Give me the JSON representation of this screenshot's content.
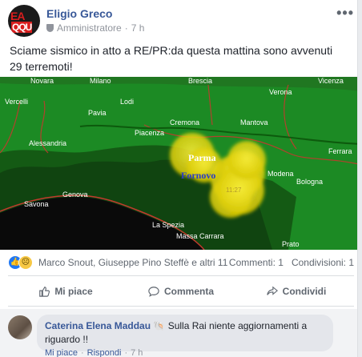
{
  "post": {
    "author": "Eligio Greco",
    "role": "Amministratore",
    "separator": "·",
    "time": "7 h",
    "more_label": "•••",
    "avatar_top": "EA",
    "avatar_bottom": "QQU",
    "text": "Sciame sismico in atto a RE/PR:da questa mattina sono avvenuti 29 terremoti!"
  },
  "map": {
    "labels": {
      "novara": "Novara",
      "milano": "Milano",
      "brescia": "Brescia",
      "vicenza": "Vicenza",
      "vercelli": "Vercelli",
      "lodi": "Lodi",
      "verona": "Verona",
      "pavia": "Pavia",
      "cremona": "Cremona",
      "mantova": "Mantova",
      "alessandria": "Alessandria",
      "piacenza": "Piacenza",
      "ferrara": "Ferrara",
      "bologna": "Bologna",
      "modena": "Modena",
      "genova": "Genova",
      "savona": "Savona",
      "la_spezia": "La Spezia",
      "massa_carrara": "Massa Carrara",
      "prato": "Prato",
      "parma": "Parma",
      "fornovo": "Fornovo",
      "time_mark": "11:27"
    },
    "colors": {
      "ground": "#1f8a1f",
      "mountain": "#0f4a0f",
      "sea": "#0c0c0c",
      "quake": "#f2e000",
      "border": "#c0392b"
    }
  },
  "engagement": {
    "reactors": "Marco Snout, Giuseppe Pino Steffè e altri 11",
    "comments": "Commenti: 1",
    "shares": "Condivisioni: 1"
  },
  "actions": {
    "like": "Mi piace",
    "comment": "Commenta",
    "share": "Condividi"
  },
  "comment": {
    "author": "Caterina Elena Maddau",
    "emoji": "🐚",
    "text": "Sulla Rai niente aggiornamenti a riguardo !!",
    "like": "Mi piace",
    "reply": "Rispondi",
    "time": "7 h",
    "dot": "·"
  }
}
